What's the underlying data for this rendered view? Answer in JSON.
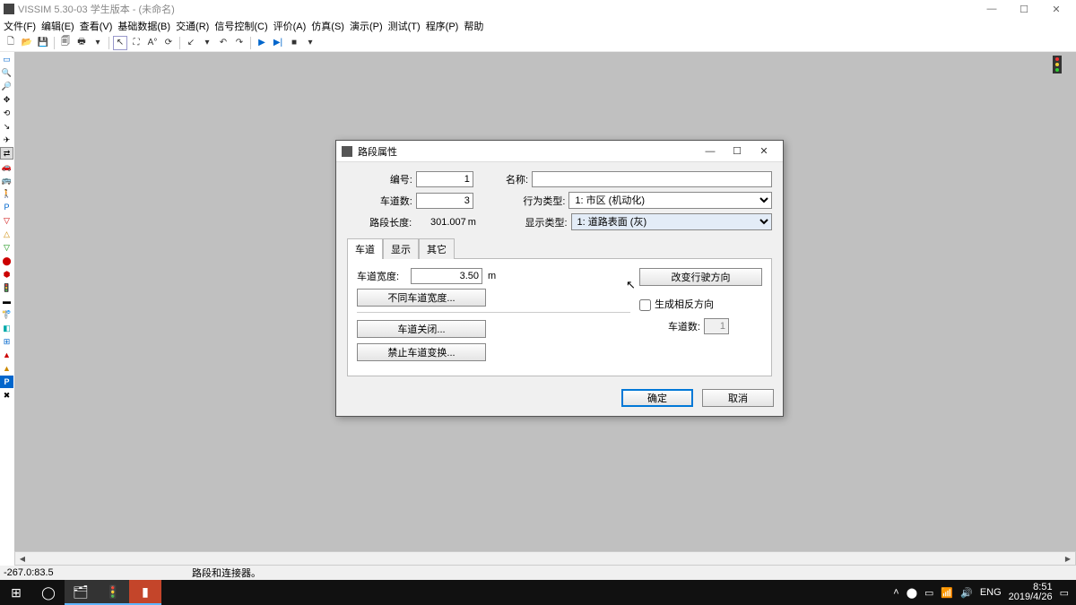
{
  "title": "VISSIM 5.30-03 学生版本 - (未命名)",
  "menu": [
    "文件(F)",
    "编辑(E)",
    "查看(V)",
    "基础数据(B)",
    "交通(R)",
    "信号控制(C)",
    "评价(A)",
    "仿真(S)",
    "演示(P)",
    "测试(T)",
    "程序(P)",
    "帮助"
  ],
  "status": {
    "coord": "-267.0:83.5",
    "hint": "路段和连接器。"
  },
  "dialog": {
    "title": "路段属性",
    "labels": {
      "id": "编号:",
      "name": "名称:",
      "lanes": "车道数:",
      "length": "路段长度:",
      "behavior": "行为类型:",
      "display": "显示类型:",
      "laneWidth": "车道宽度:"
    },
    "values": {
      "id": "1",
      "lanes": "3",
      "length": "301.007",
      "lengthUnit": "m",
      "laneWidth": "3.50",
      "laneWidthUnit": "m",
      "nameVal": ""
    },
    "behaviorOptions": "1: 市区 (机动化)",
    "displayOptions": "1: 道路表面 (灰)",
    "tabs": [
      "车道",
      "显示",
      "其它"
    ],
    "buttons": {
      "diffWidth": "不同车道宽度...",
      "laneClose": "车道关闭...",
      "forbidChange": "禁止车道变换...",
      "changeDir": "改变行驶方向",
      "genOpposite": "生成相反方向",
      "laneCountLbl": "车道数:",
      "laneCountVal": "1",
      "ok": "确定",
      "cancel": "取消"
    }
  },
  "tray": {
    "ime": "ENG",
    "time": "8:51",
    "date": "2019/4/26"
  }
}
